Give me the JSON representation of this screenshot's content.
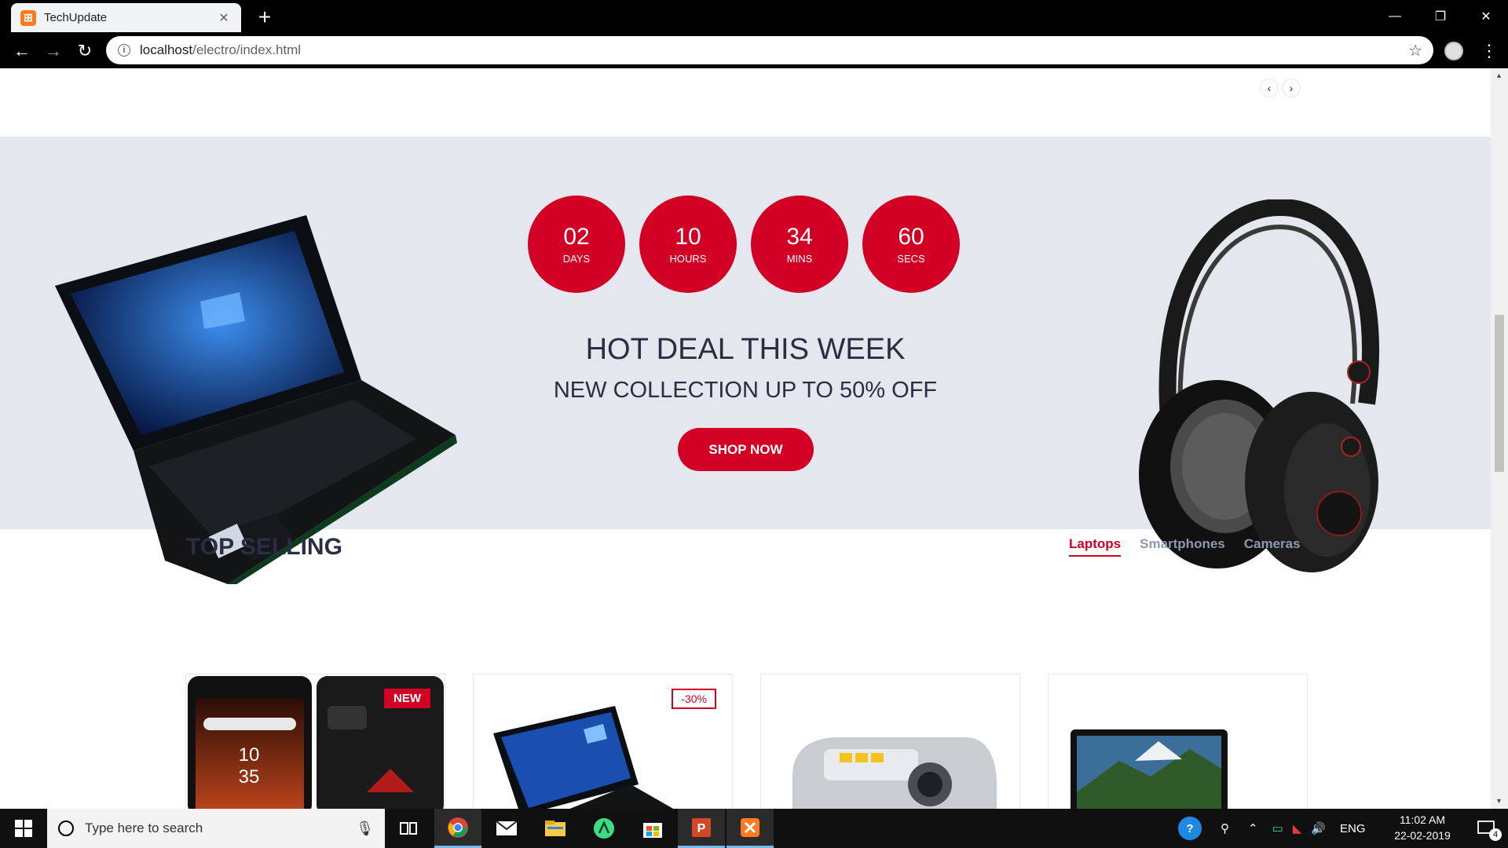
{
  "browser": {
    "tab_title": "TechUpdate",
    "favicon_glyph": "⊞",
    "url_host": "localhost",
    "url_path": "/electro/index.html"
  },
  "hot_deal": {
    "countdown": [
      {
        "value": "02",
        "label": "DAYS"
      },
      {
        "value": "10",
        "label": "HOURS"
      },
      {
        "value": "34",
        "label": "MINS"
      },
      {
        "value": "60",
        "label": "SECS"
      }
    ],
    "title": "HOT DEAL THIS WEEK",
    "subtitle": "NEW COLLECTION UP TO 50% OFF",
    "cta": "SHOP NOW"
  },
  "top_selling": {
    "title": "TOP SELLING",
    "tabs": [
      {
        "label": "Laptops",
        "active": true
      },
      {
        "label": "Smartphones",
        "active": false
      },
      {
        "label": "Cameras",
        "active": false
      }
    ],
    "products": [
      {
        "badge": "NEW",
        "badge_type": "new",
        "image": "smartphone"
      },
      {
        "badge": "-30%",
        "badge_type": "sale",
        "image": "laptop"
      },
      {
        "badge": "",
        "badge_type": "",
        "image": "camera"
      },
      {
        "badge": "",
        "badge_type": "",
        "image": "laptop-screen"
      }
    ]
  },
  "taskbar": {
    "search_placeholder": "Type here to search",
    "language": "ENG",
    "time": "11:02 AM",
    "date": "22-02-2019",
    "notification_count": "4"
  },
  "colors": {
    "accent": "#d10024",
    "deal_bg": "#e4e7ed",
    "heading": "#2b2d42",
    "muted": "#8d99ae"
  }
}
